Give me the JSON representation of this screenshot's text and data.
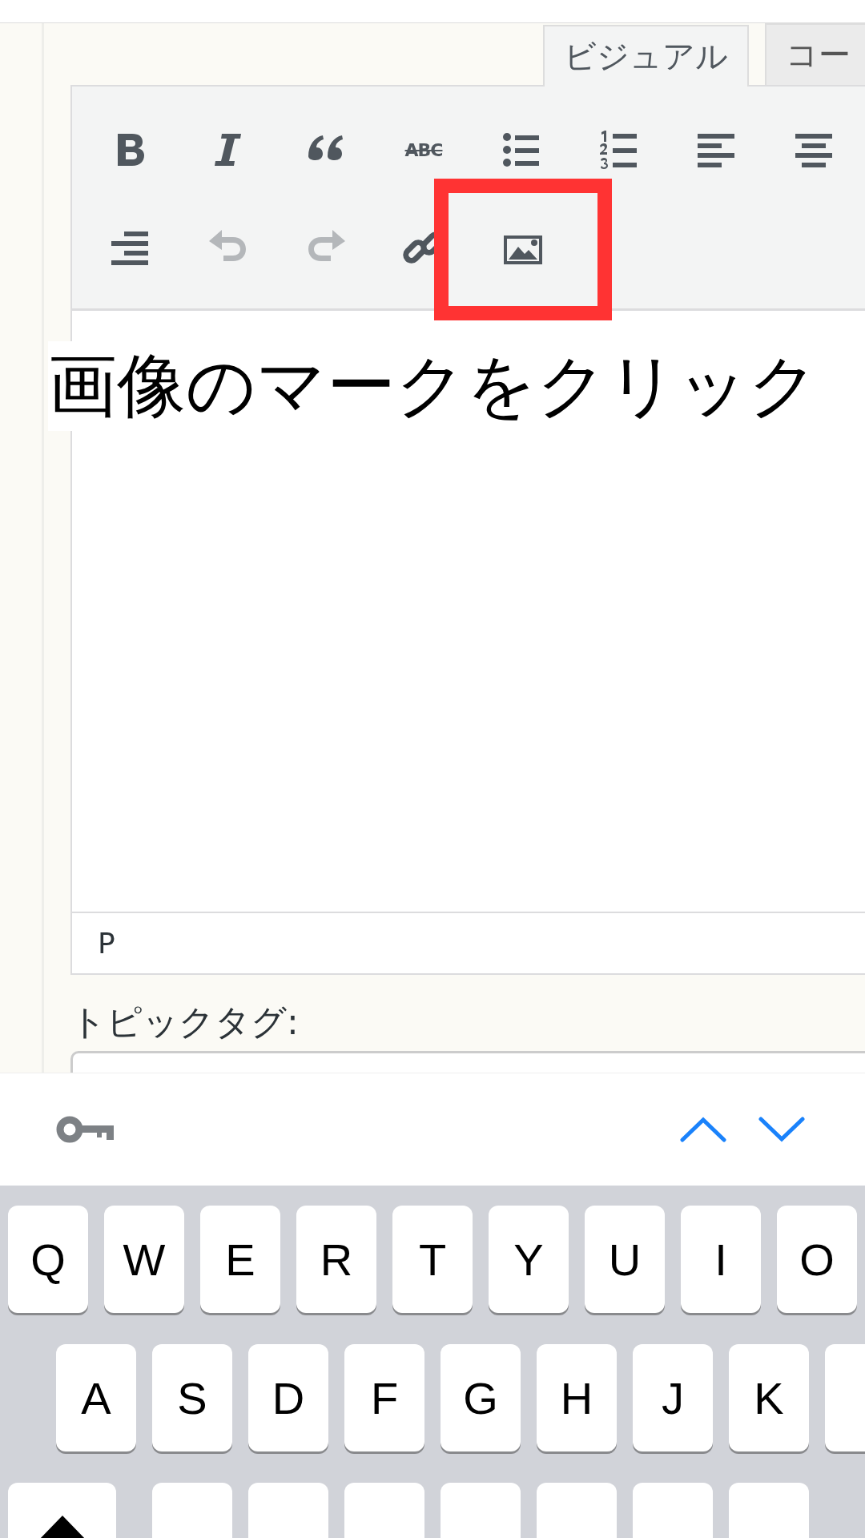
{
  "editor": {
    "tabs": [
      {
        "label": "ビジュアル",
        "selected": true
      },
      {
        "label": "コー",
        "selected": false
      }
    ],
    "toolbar": [
      {
        "kind": "bold",
        "disabled": false,
        "highlighted": false
      },
      {
        "kind": "italic",
        "disabled": false,
        "highlighted": false
      },
      {
        "kind": "quote",
        "disabled": false,
        "highlighted": false
      },
      {
        "kind": "strike",
        "label": "ABC",
        "disabled": false,
        "highlighted": false
      },
      {
        "kind": "bullets",
        "disabled": false,
        "highlighted": false
      },
      {
        "kind": "numbers",
        "disabled": false,
        "highlighted": false
      },
      {
        "kind": "align-left",
        "disabled": false,
        "highlighted": false
      },
      {
        "kind": "align-center",
        "disabled": false,
        "highlighted": false
      },
      {
        "kind": "align-right",
        "disabled": false,
        "highlighted": false
      },
      {
        "kind": "undo",
        "disabled": true,
        "highlighted": false
      },
      {
        "kind": "redo",
        "disabled": true,
        "highlighted": false
      },
      {
        "kind": "link",
        "disabled": false,
        "highlighted": false
      },
      {
        "kind": "image",
        "disabled": false,
        "highlighted": true
      }
    ],
    "annotation": "画像のマークをクリック",
    "status_path": "P"
  },
  "field_label": "トピックタグ:",
  "keyboard": {
    "rows": [
      [
        {
          "kind": "letter",
          "label": "Q"
        },
        {
          "kind": "letter",
          "label": "W"
        },
        {
          "kind": "letter",
          "label": "E"
        },
        {
          "kind": "letter",
          "label": "R"
        },
        {
          "kind": "letter",
          "label": "T"
        },
        {
          "kind": "letter",
          "label": "Y"
        },
        {
          "kind": "letter",
          "label": "U"
        },
        {
          "kind": "letter",
          "label": "I"
        },
        {
          "kind": "letter",
          "label": "O"
        }
      ],
      [
        {
          "kind": "letter",
          "label": "A"
        },
        {
          "kind": "letter",
          "label": "S"
        },
        {
          "kind": "letter",
          "label": "D"
        },
        {
          "kind": "letter",
          "label": "F"
        },
        {
          "kind": "letter",
          "label": "G"
        },
        {
          "kind": "letter",
          "label": "H"
        },
        {
          "kind": "letter",
          "label": "J"
        },
        {
          "kind": "letter",
          "label": "K"
        },
        {
          "kind": "blank"
        }
      ],
      [
        {
          "kind": "shift"
        },
        {
          "kind": "blank"
        },
        {
          "kind": "blank"
        },
        {
          "kind": "blank"
        },
        {
          "kind": "blank"
        },
        {
          "kind": "blank"
        },
        {
          "kind": "blank"
        },
        {
          "kind": "blank"
        }
      ]
    ]
  }
}
